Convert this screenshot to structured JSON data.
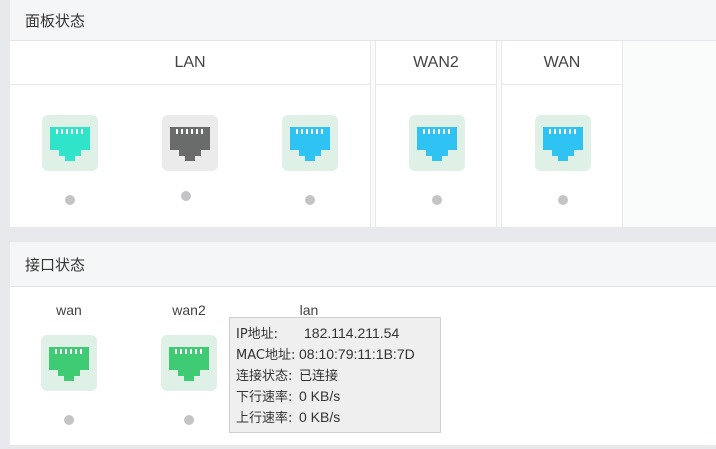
{
  "panel_status": {
    "title": "面板状态",
    "groups": [
      {
        "label": "LAN"
      },
      {
        "label": "WAN2"
      },
      {
        "label": "WAN"
      }
    ]
  },
  "interface_status": {
    "title": "接口状态",
    "interfaces": [
      {
        "label": "wan"
      },
      {
        "label": "wan2"
      },
      {
        "label": "lan"
      }
    ]
  },
  "tooltip": {
    "rows": [
      {
        "key": "IP地址:",
        "value": "182.114.211.54"
      },
      {
        "key": "MAC地址:",
        "value": "08:10:79:11:1B:7D"
      },
      {
        "key": "连接状态:",
        "value": "已连接"
      },
      {
        "key": "下行速率:",
        "value": "0 KB/s"
      },
      {
        "key": "上行速率:",
        "value": "0 KB/s"
      }
    ]
  },
  "colors": {
    "port_teal": "#2fe4c8",
    "port_gray": "#6a6b6b",
    "port_blue": "#2ec3f2",
    "port_green": "#3fcb73",
    "port_bg_light": "#dff1e6",
    "port_bg_gray": "#ebebeb",
    "status_dot": "#c2c4c6"
  },
  "icons": {
    "port": "ethernet-port-icon",
    "status": "status-dot-icon"
  }
}
